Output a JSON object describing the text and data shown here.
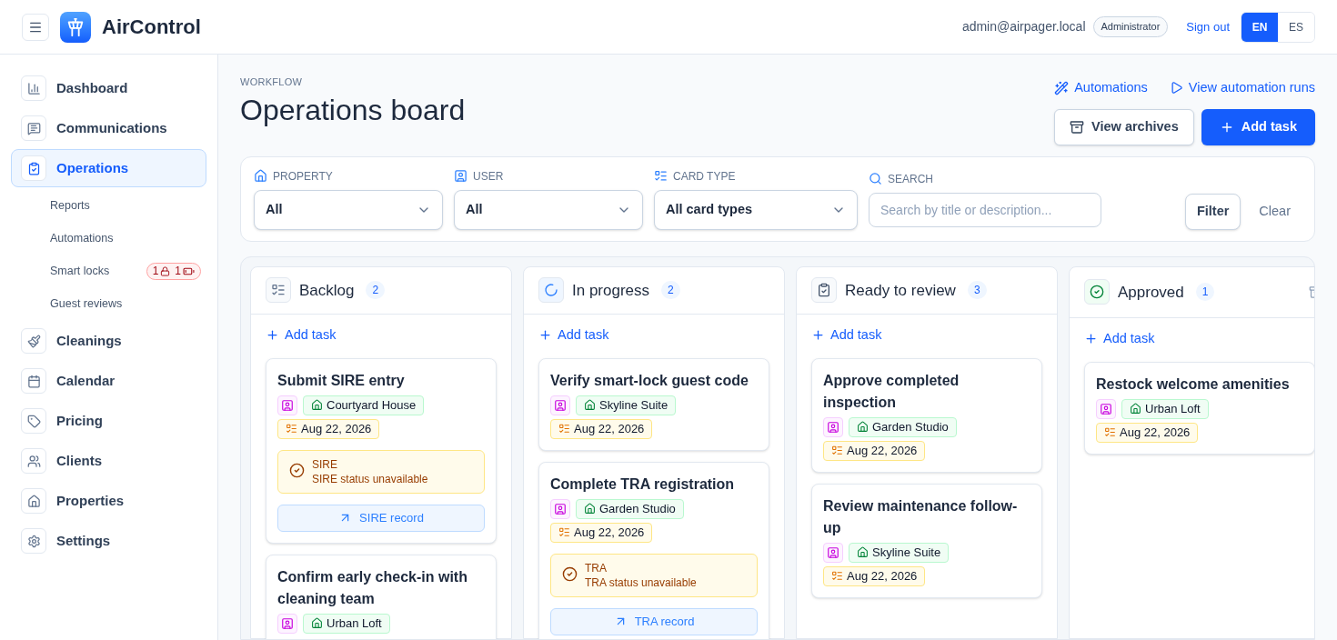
{
  "app": {
    "name": "AirControl"
  },
  "header": {
    "email": "admin@airpager.local",
    "role": "Administrator",
    "sign_out": "Sign out",
    "languages": [
      {
        "label": "EN",
        "selected": true
      },
      {
        "label": "ES",
        "selected": false
      }
    ]
  },
  "sidebar": {
    "items": [
      {
        "label": "Dashboard",
        "selected": false
      },
      {
        "label": "Communications",
        "selected": false
      },
      {
        "label": "Operations",
        "selected": true,
        "children": [
          {
            "label": "Reports"
          },
          {
            "label": "Automations"
          },
          {
            "label": "Smart locks",
            "badge": {
              "locks": "1",
              "batteries": "1"
            }
          },
          {
            "label": "Guest reviews"
          }
        ]
      },
      {
        "label": "Cleanings",
        "selected": false
      },
      {
        "label": "Calendar",
        "selected": false
      },
      {
        "label": "Pricing",
        "selected": false
      },
      {
        "label": "Clients",
        "selected": false
      },
      {
        "label": "Properties",
        "selected": false
      },
      {
        "label": "Settings",
        "selected": false
      }
    ]
  },
  "page": {
    "eyebrow": "WORKFLOW",
    "title": "Operations board",
    "links": [
      "Automations",
      "View automation runs"
    ],
    "view_archives": "View archives",
    "add_task": "Add task"
  },
  "filters": {
    "selects": [
      {
        "label": "PROPERTY",
        "value": "All"
      },
      {
        "label": "USER",
        "value": "All"
      },
      {
        "label": "CARD TYPE",
        "value": "All card types"
      }
    ],
    "search": {
      "label": "SEARCH",
      "placeholder": "Search by title or description..."
    },
    "filter_button": "Filter",
    "clear_button": "Clear"
  },
  "columns": [
    {
      "title": "Backlog",
      "kind": "backlog",
      "count": "2",
      "add_task": "Add task",
      "archive": false,
      "cards": [
        {
          "title": "Submit SIRE entry",
          "property": "Courtyard House",
          "date": "Aug 22, 2026",
          "notice": {
            "label": "SIRE",
            "message": "SIRE status unavailable"
          },
          "link": "SIRE record"
        },
        {
          "title": "Confirm early check-in with cleaning team",
          "property": "Urban Loft"
        }
      ]
    },
    {
      "title": "In progress",
      "kind": "progress",
      "count": "2",
      "add_task": "Add task",
      "archive": false,
      "cards": [
        {
          "title": "Verify smart-lock guest code",
          "property": "Skyline Suite",
          "date": "Aug 22, 2026"
        },
        {
          "title": "Complete TRA registration",
          "property": "Garden Studio",
          "date": "Aug 22, 2026",
          "notice": {
            "label": "TRA",
            "message": "TRA status unavailable"
          },
          "link": "TRA record"
        }
      ]
    },
    {
      "title": "Ready to review",
      "kind": "review",
      "count": "3",
      "add_task": "Add task",
      "archive": false,
      "cards": [
        {
          "title": "Approve completed inspection",
          "property": "Garden Studio",
          "date": "Aug 22, 2026"
        },
        {
          "title": "Review maintenance follow-up",
          "property": "Skyline Suite",
          "date": "Aug 22, 2026"
        }
      ]
    },
    {
      "title": "Approved",
      "kind": "approved",
      "count": "1",
      "add_task": "Add task",
      "archive": true,
      "cards": [
        {
          "title": "Restock welcome amenities",
          "property": "Urban Loft",
          "date": "Aug 22, 2026"
        }
      ]
    }
  ]
}
